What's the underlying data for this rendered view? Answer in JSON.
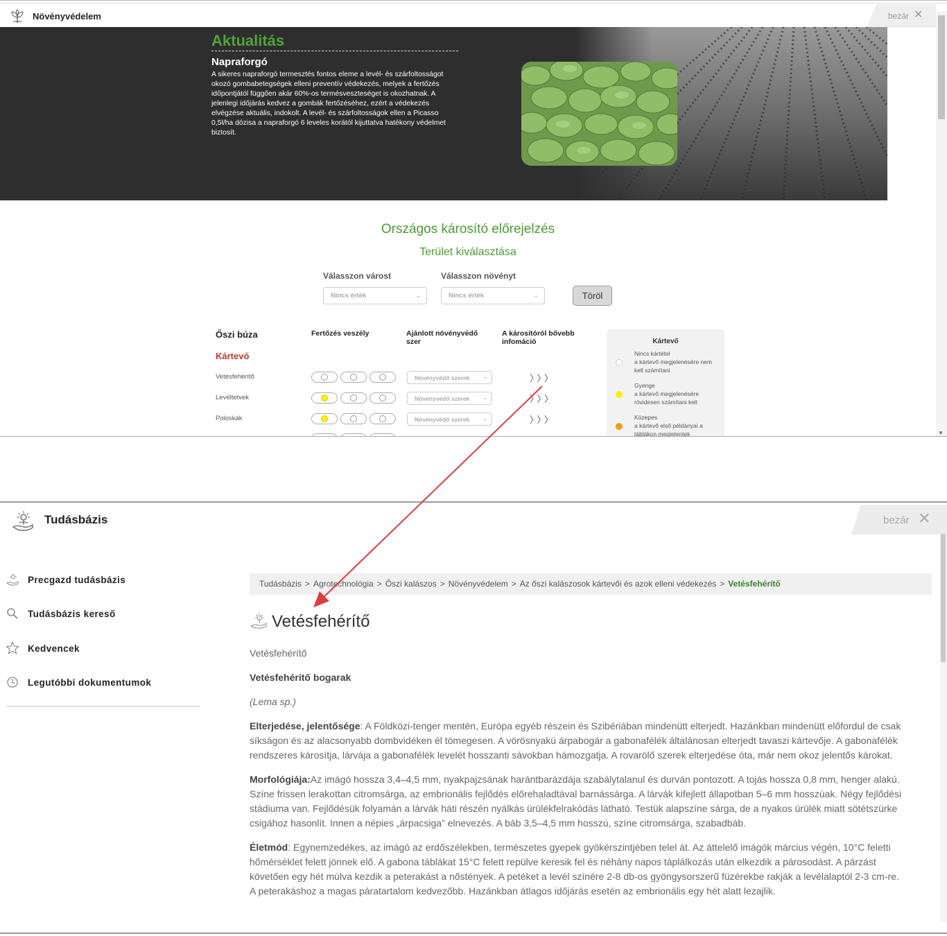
{
  "top_window": {
    "title": "Növényvédelem",
    "close_label": "bezár",
    "banner": {
      "heading": "Aktualitás",
      "subheading": "Napraforgó",
      "text": "A sikeres napraforgó termesztés fontos eleme a levél- és szárfoltosságot okozó gombabetegségek elleni preventív védekezés, melyek a fertőzés időpontjától függően akár 60%-os termésveszteséget is okozhatnak. A jelenlegi időjárás kedvez a gombák fertőzéséhez, ezért a védekezés elvégzése aktuális, indokolt. A levél- és szárfoltosságok ellen a Picasso 0,5l/ha dózisa a napraforgó 6 leveles korától kijuttatva hatékony védelmet biztosít."
    },
    "forecast": {
      "title": "Országos károsító előrejelzés",
      "area_title": "Terület kiválasztása",
      "city_label": "Válasszon várost",
      "plant_label": "Válasszon növényt",
      "city_value": "Nincs érték",
      "plant_value": "Nincs érték",
      "clear_button": "Töröl"
    },
    "table": {
      "crop": "Őszi búza",
      "col_risk": "Fertőzés veszély",
      "col_product": "Ajánlott növényvédő szer",
      "col_info": "A károsítóról bővebb infomáció",
      "category": "Kártevő",
      "rows": [
        {
          "name": "Vetésfehérítő",
          "risk_level": 0,
          "product": "Növényvédő szerek"
        },
        {
          "name": "Levéltetvek",
          "risk_level": 1,
          "product": "Növényvédő szerek"
        },
        {
          "name": "Poloskák",
          "risk_level": 1,
          "product": "Növényvédő szerek"
        }
      ]
    },
    "legend": {
      "title": "Kártevő",
      "items": [
        {
          "name": "Nincs kártétel",
          "desc": "a kártevő megjelenésére nem kell számítani",
          "color": "#ffffff"
        },
        {
          "name": "Gyenge",
          "desc": "a kártevő megjelenésére rövidesen számítani kell",
          "color": "#ffee00"
        },
        {
          "name": "Közepes",
          "desc": "a kártevő első példányai a táblákon megjelentek",
          "color": "#f39c12"
        }
      ]
    }
  },
  "bottom_window": {
    "title": "Tudásbázis",
    "close_label": "bezár",
    "nav": [
      {
        "label": "Precgazd tudásbázis",
        "icon": "plant-hand-icon"
      },
      {
        "label": "Tudásbázis kereső",
        "icon": "search-icon"
      },
      {
        "label": "Kedvencek",
        "icon": "star-icon"
      },
      {
        "label": "Legutóbbi dokumentumok",
        "icon": "clock-icon"
      }
    ],
    "breadcrumb": [
      "Tudásbázis",
      "Agrotechnológia",
      "Őszi kalászos",
      "Növényvédelem",
      "Az őszi kalászosok kártevői és azok elleni védekezés"
    ],
    "breadcrumb_current": "Vetésfehérítő",
    "doc_title": "Vetésfehérítő",
    "content": {
      "p1": "Vetésfehérítő",
      "p2": "Vetésfehérítő bogarak",
      "p3": "(Lema sp.)",
      "p4_label": "Elterjedése, jelentősége",
      "p4_text": ": A Földközi-tenger mentén, Európa egyéb részein és Szibériában mindenütt elterjedt. Hazánkban mindenütt előfordul de csak síkságon és az alacsonyabb dombvidéken él tömegesen. A vörösnyakú árpabogár a gabonafélék általánosan elterjedt tavaszi kártevője. A gabonafélék rendszeres károsítja, lárvája a gabonafélék levelét hosszanti sávokban hámozgatja. A rovarölő szerek elterjedése óta, már nem okoz jelentős károkat.",
      "p5_label": "Morfológiája:",
      "p5_text": "Az imágó hossza 3,4–4,5 mm, nyakpajzsának harántbarázdája szabálytalanul és durván pontozott. A tojás hossza 0,8 mm, henger alakú. Színe frissen lerakottan citromsárga, az embrionális fejlődés előrehaladtával barnássárga. A lárvák kifejlett állapotban 5–6 mm hosszúak. Négy fejlődési stádiuma van. Fejlődésük folyamán a lárvák háti részén nyálkás ürülékfelrakódás látható. Testük alapszíne sárga, de a nyakos ürülék miatt sötétszürke csigához hasonlít. Innen a népies „árpacsiga” elnevezés. A báb 3,5–4,5 mm hosszú, színe citromsárga, szabadbáb.",
      "p6_label": "Életmód",
      "p6_text": ": Egynemzedékes, az imágó az erdőszélekben, természetes gyepek gyökérszintjében telel át. Az áttelelő imágók március végén, 10°C feletti hőmérséklet felett jönnek elő. A gabona táblákat 15°C felett repülve keresik fel és néhány napos táplálkozás után elkezdik a párosodást. A párzást követően egy hét múlva kezdik a peterakást a nőstények. A petéket a levél színére 2-8 db-os gyöngysorszerű füzérekbe rakják a levélalaptól 2-3 cm-re. A peterakáshoz a magas páratartalom kedvezőbb. Hazánkban átlagos időjárás esetén az embrionális egy hét alatt lezajlik."
    }
  }
}
